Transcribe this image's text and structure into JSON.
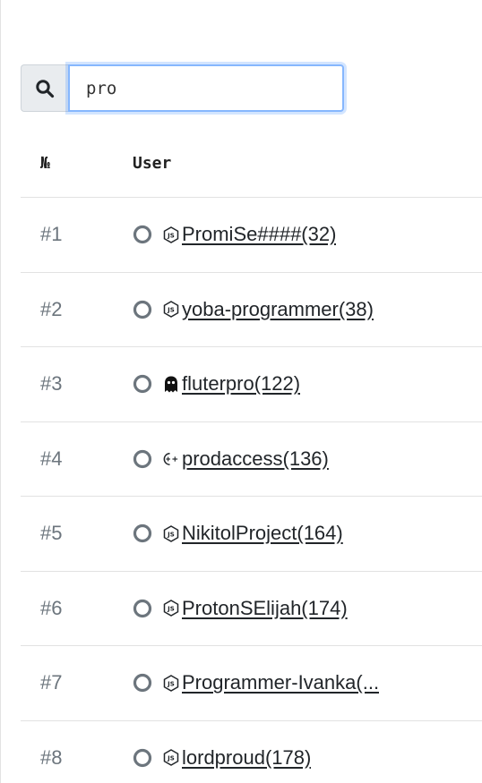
{
  "search": {
    "value": "pro",
    "icon": "search-icon"
  },
  "table": {
    "headers": {
      "number": "№",
      "user": "User"
    },
    "rows": [
      {
        "rank": "#1",
        "user": "PromiSe####(32)",
        "lang_icon": "nodejs-icon"
      },
      {
        "rank": "#2",
        "user": "yoba-programmer(38)",
        "lang_icon": "nodejs-icon"
      },
      {
        "rank": "#3",
        "user": "fluterpro(122)",
        "lang_icon": "ghost-icon"
      },
      {
        "rank": "#4",
        "user": "prodaccess(136)",
        "lang_icon": "cpp-icon"
      },
      {
        "rank": "#5",
        "user": "NikitolProject(164)",
        "lang_icon": "nodejs-icon"
      },
      {
        "rank": "#6",
        "user": "ProtonSElijah(174)",
        "lang_icon": "nodejs-icon"
      },
      {
        "rank": "#7",
        "user": "Programmer-Ivanka(...",
        "lang_icon": "nodejs-icon"
      },
      {
        "rank": "#8",
        "user": "lordproud(178)",
        "lang_icon": "nodejs-icon"
      }
    ]
  },
  "colors": {
    "rank_text": "#6c757d",
    "radio": "#6c757d",
    "input_focus_border": "#86b7fe"
  }
}
